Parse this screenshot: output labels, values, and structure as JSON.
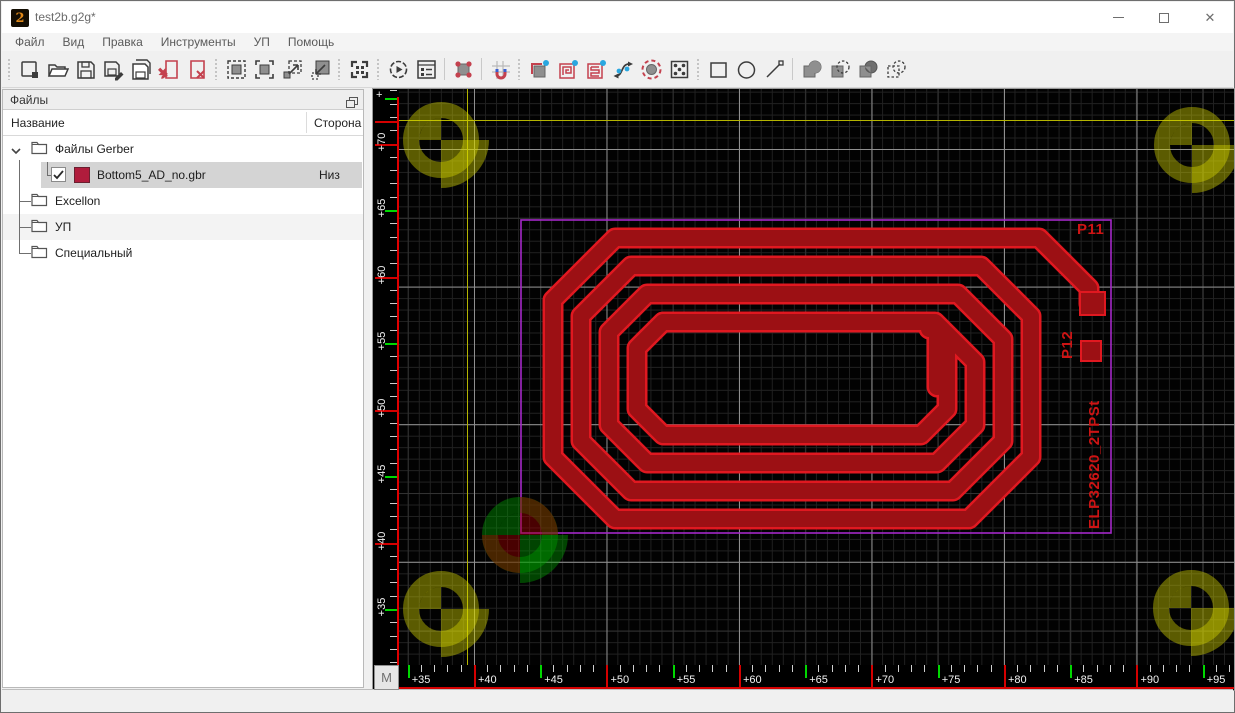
{
  "window": {
    "title": "test2b.g2g*",
    "app_icon": "2",
    "controls": {
      "minimize": "minimize",
      "maximize": "maximize",
      "close": "✕"
    }
  },
  "menu": {
    "items": [
      "Файл",
      "Вид",
      "Правка",
      "Инструменты",
      "УП",
      "Помощь"
    ]
  },
  "toolbar": {
    "groups": [
      {
        "handle": true,
        "icons": [
          "new-file",
          "open-file",
          "save-file",
          "save-file-as",
          "save-all",
          "import-file",
          "close-file"
        ]
      },
      {
        "handle": true,
        "icons": [
          "zoom-selection",
          "zoom-window",
          "zoom-extents",
          "zoom-object"
        ]
      },
      {
        "handle": true,
        "icons": [
          "fit-all"
        ]
      },
      {
        "handle": true,
        "icons": [
          "run-job",
          "job-properties"
        ]
      },
      {
        "handle": false,
        "icons": [
          "transform-object"
        ]
      },
      {
        "handle": false,
        "icons": [
          "snap-grid"
        ]
      },
      {
        "handle": true,
        "icons": [
          "new-region",
          "new-coil",
          "new-meander",
          "edit-curve",
          "new-pad",
          "new-array"
        ]
      },
      {
        "handle": true,
        "icons": [
          "draw-rect",
          "draw-circle",
          "draw-line"
        ]
      },
      {
        "handle": false,
        "icons": [
          "bool-union",
          "bool-subtract",
          "bool-intersect",
          "bool-xor"
        ]
      }
    ]
  },
  "files_panel": {
    "title": "Файлы",
    "columns": {
      "name": "Название",
      "side": "Сторона"
    },
    "tree": [
      {
        "label": "Файлы Gerber",
        "type": "folder",
        "expanded": true,
        "children": [
          {
            "label": "Bottom5_AD_no.gbr",
            "side": "Низ",
            "checked": true,
            "swatch_color": "#B01C3C",
            "selected": true
          }
        ]
      },
      {
        "label": "Excellon",
        "type": "folder"
      },
      {
        "label": "УП",
        "type": "folder"
      },
      {
        "label": "Специальный",
        "type": "folder"
      }
    ]
  },
  "canvas": {
    "m_button": "M",
    "h_ruler": {
      "labels": [
        "+35",
        "+40",
        "+45",
        "+50",
        "+55",
        "+60",
        "+65",
        "+70",
        "+75",
        "+80",
        "+85",
        "+90",
        "+95"
      ]
    },
    "v_ruler": {
      "labels": [
        "+70",
        "+65",
        "+60",
        "+55",
        "+50",
        "+45",
        "+40",
        "+35"
      ],
      "partial_top_label": "+"
    },
    "board": {
      "p11": "P11",
      "p12": "P12",
      "part_number": "ELP32620_2TPSt"
    },
    "colors": {
      "trace_fill": "#9C1014",
      "trace_edge": "#E01820",
      "board_outline": "#A428C8",
      "fiducial_yellow": "#D6D600",
      "fiducial_green": "#00A000",
      "fiducial_red": "#A00000",
      "ruler_red": "#D40000",
      "ruler_green": "#00D800",
      "guide_yellow": "#B4B400",
      "selection_bg": "#D4D4D4",
      "layer_swatch": "#B01C3C"
    }
  }
}
